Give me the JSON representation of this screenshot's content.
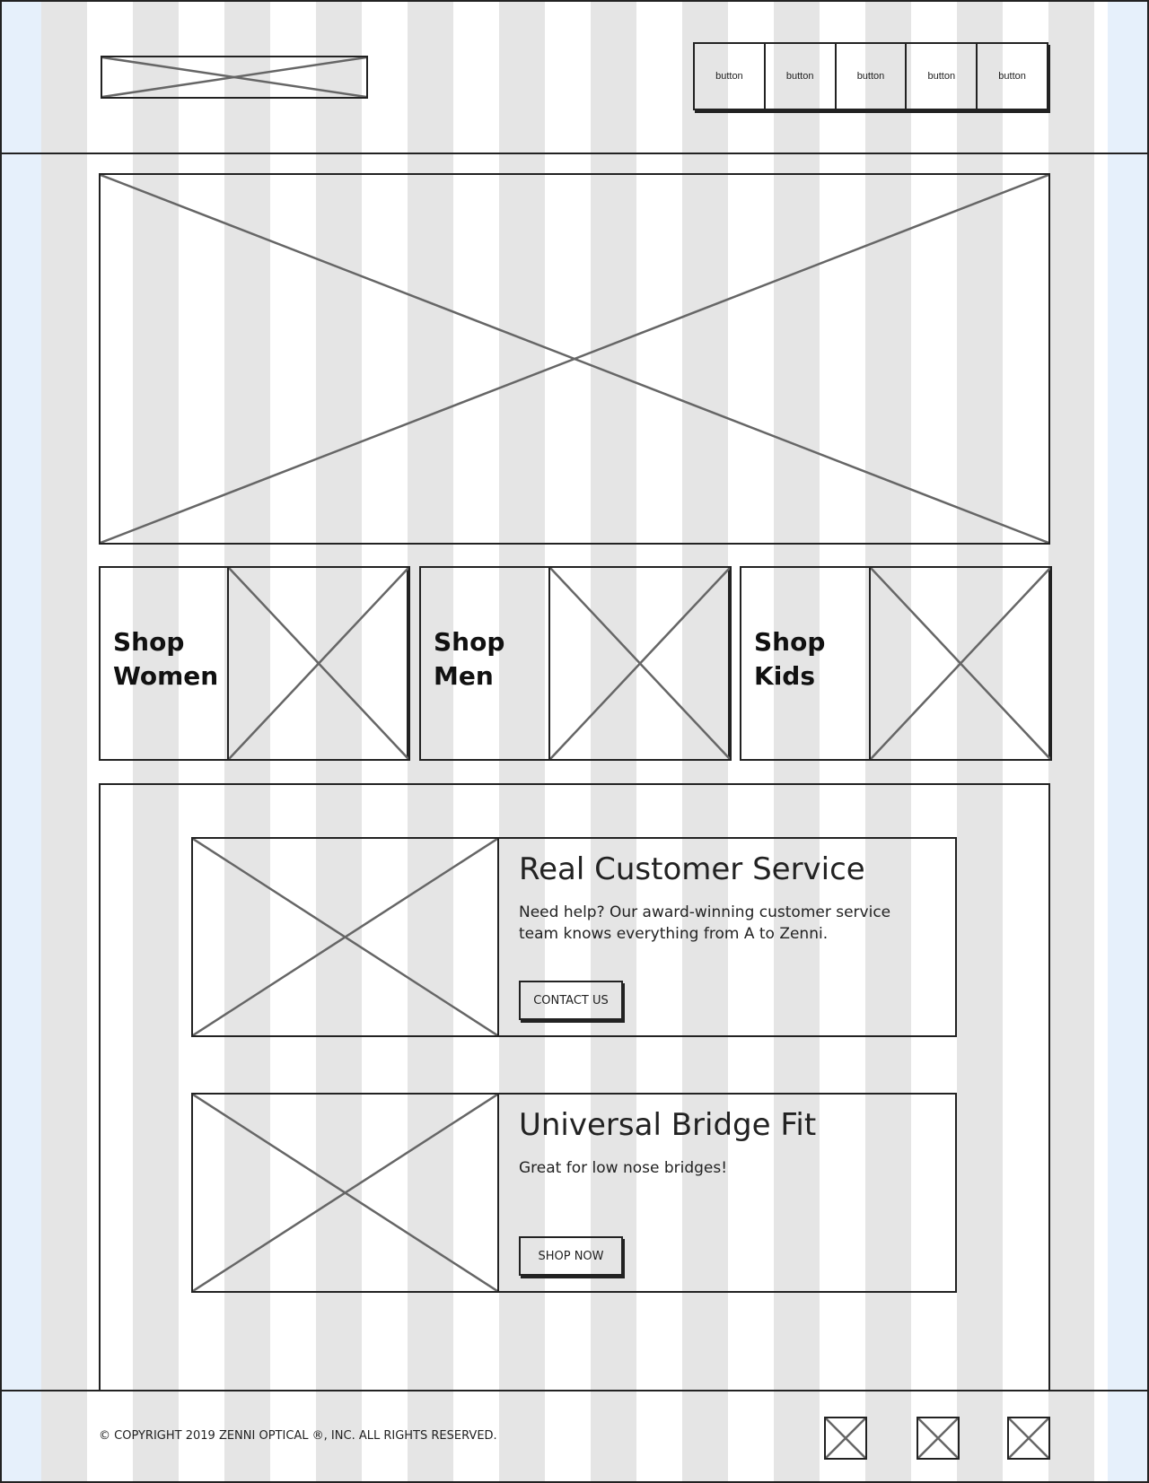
{
  "header": {
    "nav_buttons": [
      "button",
      "button",
      "button",
      "button",
      "button"
    ]
  },
  "categories": [
    {
      "label": "Shop\nWomen"
    },
    {
      "label": "Shop\nMen"
    },
    {
      "label": "Shop\nKids"
    }
  ],
  "features": [
    {
      "title": "Real Customer Service",
      "text": "Need help? Our award-winning customer service team knows everything from A to Zenni.",
      "cta": "CONTACT US"
    },
    {
      "title": "Universal Bridge Fit",
      "text": "Great for low nose bridges!",
      "cta": "SHOP NOW"
    }
  ],
  "footer": {
    "copyright": "© COPYRIGHT 2019 ZENNI OPTICAL ®, INC. ALL RIGHTS RESERVED."
  }
}
